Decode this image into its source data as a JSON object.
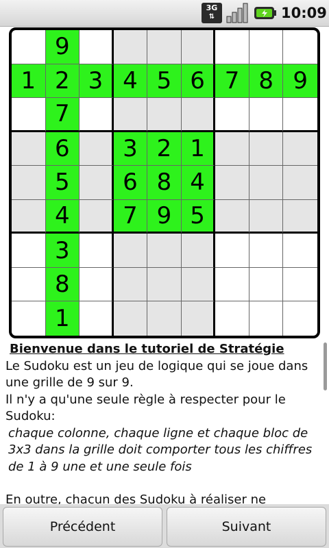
{
  "statusbar": {
    "network": "3G",
    "clock": "10:09",
    "icons": [
      "3g-icon",
      "signal-icon",
      "battery-charging-icon"
    ]
  },
  "colors": {
    "highlight": "#2ef21c",
    "shaded_block": "#e5e5e5",
    "plain": "#ffffff"
  },
  "grid": {
    "cells": [
      [
        "",
        "9",
        "",
        "",
        "",
        "",
        "",
        "",
        ""
      ],
      [
        "1",
        "2",
        "3",
        "4",
        "5",
        "6",
        "7",
        "8",
        "9"
      ],
      [
        "",
        "7",
        "",
        "",
        "",
        "",
        "",
        "",
        ""
      ],
      [
        "",
        "6",
        "",
        "3",
        "2",
        "1",
        "",
        "",
        ""
      ],
      [
        "",
        "5",
        "",
        "6",
        "8",
        "4",
        "",
        "",
        ""
      ],
      [
        "",
        "4",
        "",
        "7",
        "9",
        "5",
        "",
        "",
        ""
      ],
      [
        "",
        "3",
        "",
        "",
        "",
        "",
        "",
        "",
        ""
      ],
      [
        "",
        "8",
        "",
        "",
        "",
        "",
        "",
        "",
        ""
      ],
      [
        "",
        "1",
        "",
        "",
        "",
        "",
        "",
        "",
        ""
      ]
    ],
    "highlighted_row": 1,
    "highlighted_col": 1,
    "highlighted_block": [
      1,
      1
    ]
  },
  "tutorial": {
    "title": "Bienvenue dans le tutoriel de Stratégie",
    "paragraph1": " Le Sudoku est un jeu de logique qui se joue dans une grille de 9 sur 9.",
    "paragraph2": " Il n'y a qu'une seule règle à respecter pour le Sudoku:",
    "rule": "chaque colonne, chaque ligne et chaque bloc de 3x3 dans la grille doit comporter tous les chiffres de 1 à 9 une et une seule fois",
    "paragraph3": " En outre, chacun des Sudoku à réaliser ne"
  },
  "buttons": {
    "previous": "Précédent",
    "next": "Suivant"
  }
}
